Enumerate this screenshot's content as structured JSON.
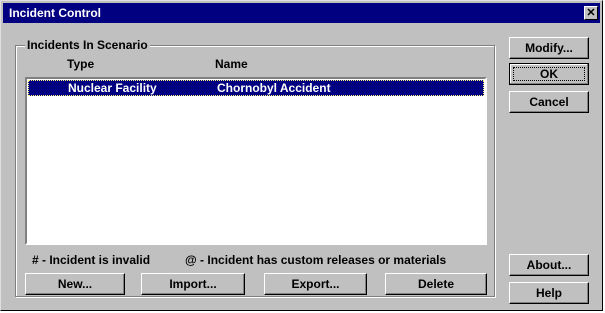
{
  "window": {
    "title": "Incident Control",
    "close_glyph": "✕"
  },
  "group": {
    "label": "Incidents In Scenario",
    "columns": [
      "Type",
      "Name"
    ],
    "rows": [
      {
        "type": "Nuclear Facility",
        "name": "Chornobyl Accident",
        "selected": true
      }
    ]
  },
  "legend": {
    "invalid": "# - Incident is invalid",
    "custom": "@ - Incident has custom releases or materials"
  },
  "buttons": {
    "modify": "Modify...",
    "ok": "OK",
    "cancel": "Cancel",
    "about": "About...",
    "help": "Help",
    "new": "New...",
    "import": "Import...",
    "export": "Export...",
    "delete": "Delete"
  },
  "colors": {
    "titlebar": "#000080",
    "dialog": "#c0c0c0",
    "selection": "#000080"
  }
}
